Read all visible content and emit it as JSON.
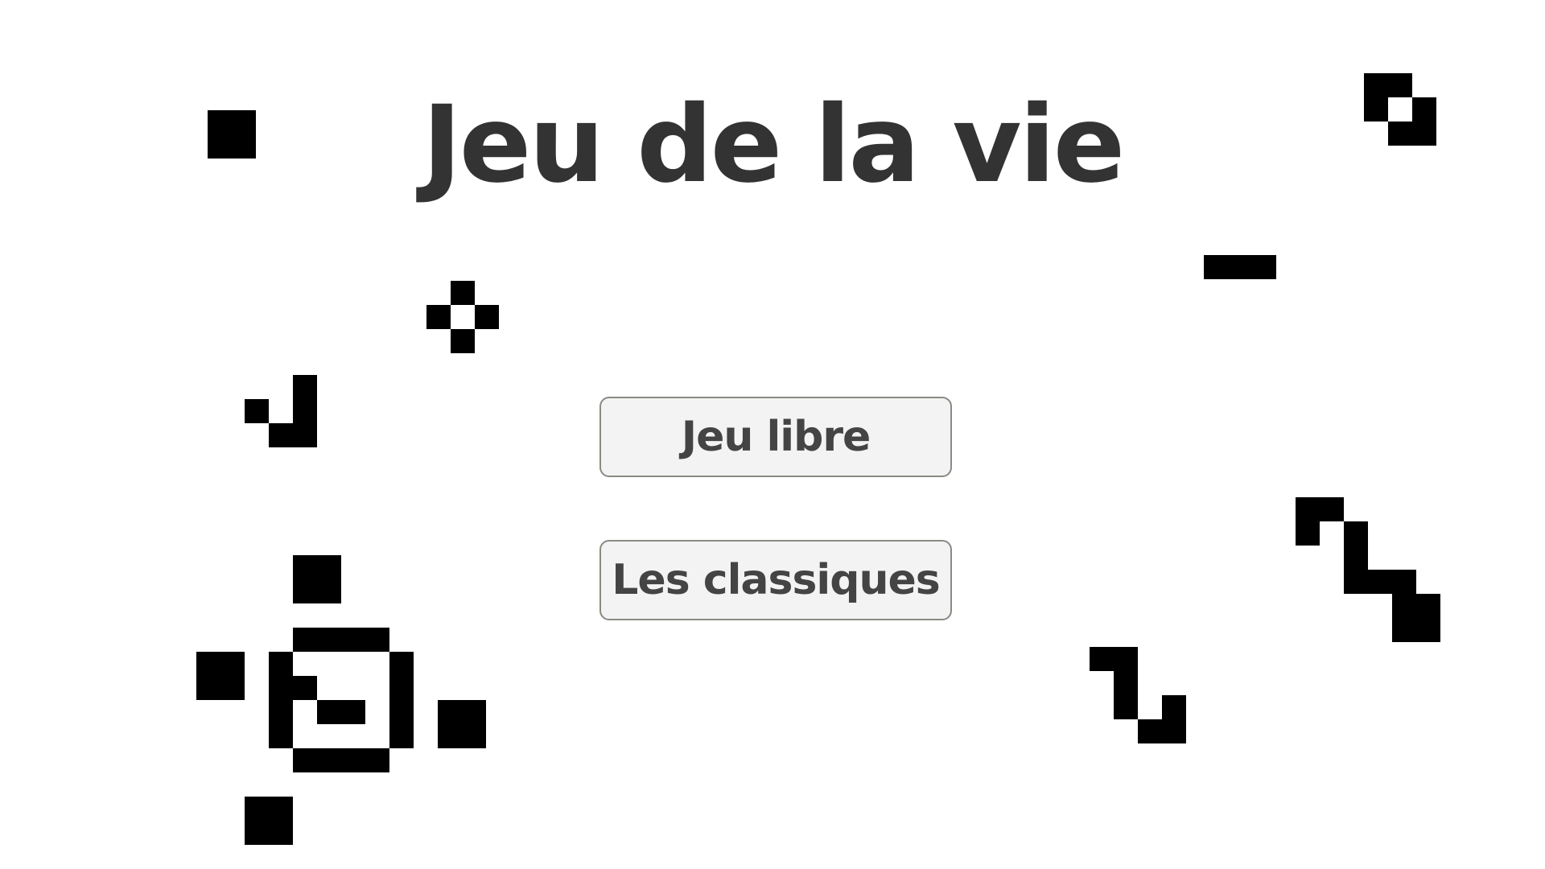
{
  "title": "Jeu de la vie",
  "menu": {
    "free_play_label": "Jeu libre",
    "classics_label": "Les classiques"
  },
  "colors": {
    "background": "#ffffff",
    "title": "#333333",
    "button_text": "#444444",
    "button_background": "#f3f3f3",
    "button_border": "#8a8a82",
    "cell": "#000000"
  },
  "board": {
    "patterns": [
      "block",
      "glider",
      "diamond",
      "glider",
      "blinker",
      "snake",
      "snake",
      "oscillator"
    ]
  }
}
